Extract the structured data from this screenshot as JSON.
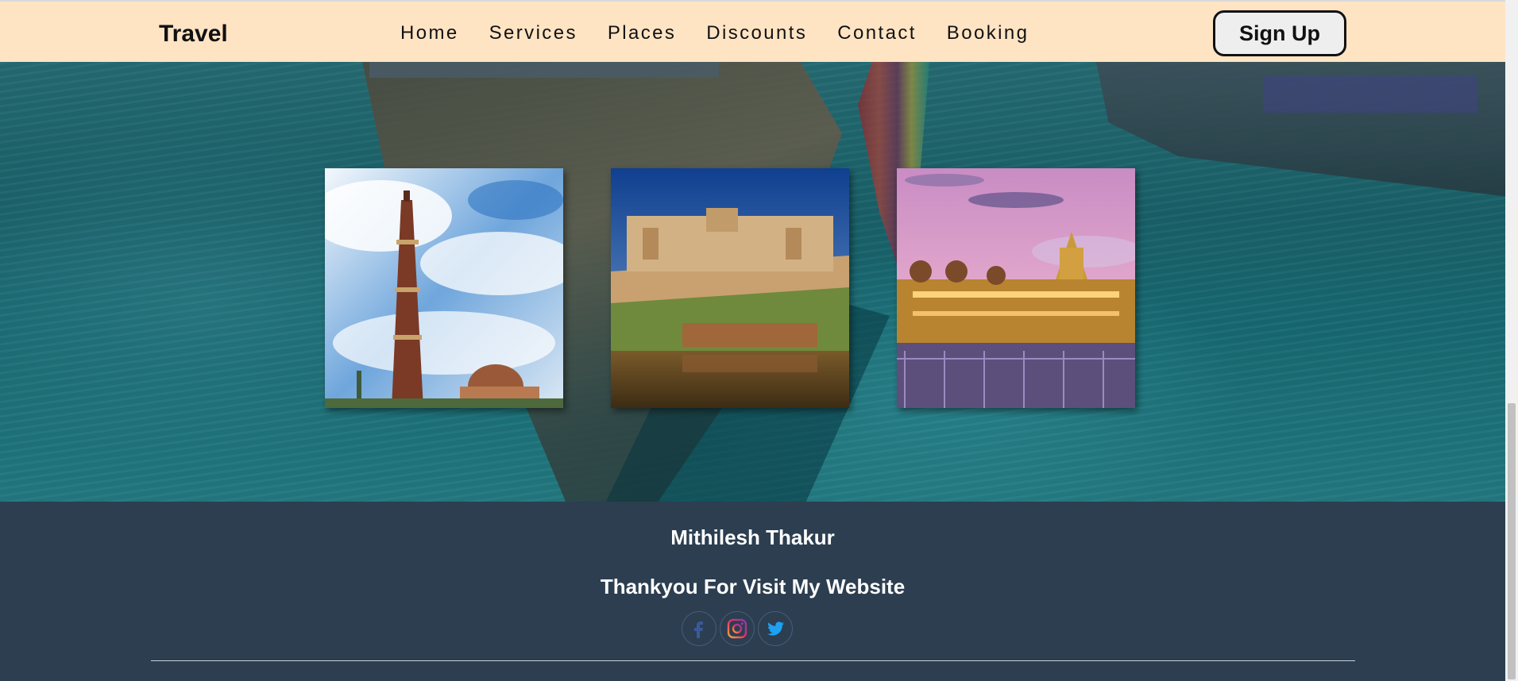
{
  "header": {
    "brand": "Travel",
    "nav": [
      {
        "label": "Home"
      },
      {
        "label": "Services"
      },
      {
        "label": "Places"
      },
      {
        "label": "Discounts"
      },
      {
        "label": "Contact"
      },
      {
        "label": "Booking"
      }
    ],
    "signup_label": "Sign Up",
    "background_color": "#ffe4c4"
  },
  "gallery": {
    "cards": [
      {
        "subject": "tall brick minaret tower with domed building under blue cloudy sky"
      },
      {
        "subject": "hilltop fort palace with reflection in lake under blue sky"
      },
      {
        "subject": "illuminated palace at dusk with purple sky and ornate gate"
      }
    ]
  },
  "footer": {
    "name": "Mithilesh Thakur",
    "message": "Thankyou For Visit My Website",
    "socials": [
      {
        "icon": "facebook-icon"
      },
      {
        "icon": "instagram-icon"
      },
      {
        "icon": "twitter-icon"
      }
    ],
    "background_color": "#2c3e50"
  }
}
